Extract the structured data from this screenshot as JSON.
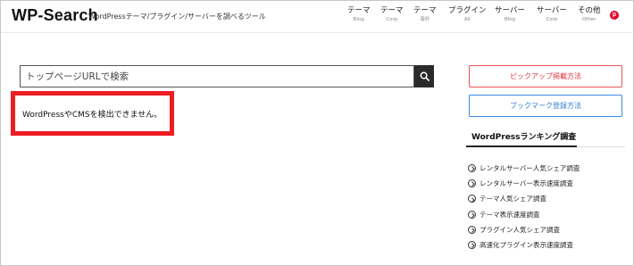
{
  "header": {
    "logo": "WP-Search",
    "tagline": "WordPressテーマ/プラグイン/サーバーを調べるツール",
    "nav": [
      {
        "label": "テーマ",
        "sub": "Blog"
      },
      {
        "label": "テーマ",
        "sub": "Corp"
      },
      {
        "label": "テーマ",
        "sub": "海外"
      },
      {
        "label": "プラグイン",
        "sub": "All"
      },
      {
        "label": "サーバー",
        "sub": "Blog"
      },
      {
        "label": "サーバー",
        "sub": "Corp"
      },
      {
        "label": "その他",
        "sub": "Other"
      }
    ],
    "pinterest_glyph": "p"
  },
  "search": {
    "placeholder": "トップページURLで検索"
  },
  "result": {
    "message": "WordPressやCMSを検出できません。"
  },
  "sidebar": {
    "pickup_label": "ピックアップ掲載方法",
    "bookmark_label": "ブックマーク登録方法",
    "ranking_title": "WordPressランキング調査",
    "ranking_items": [
      "レンタルサーバー人気シェア調査",
      "レンタルサーバー表示速度調査",
      "テーマ人気シェア調査",
      "テーマ表示速度調査",
      "プラグイン人気シェア調査",
      "高速化プラグイン表示速度調査"
    ]
  },
  "colors": {
    "highlight_border": "#ee1d23",
    "pickup": "#e33a40",
    "bookmark": "#2f7fd1",
    "pinterest": "#e60023"
  },
  "icons": {
    "search_button": "search-icon",
    "pinterest": "pinterest-icon",
    "ranking_bullet": "circle-arrow-right-icon"
  }
}
